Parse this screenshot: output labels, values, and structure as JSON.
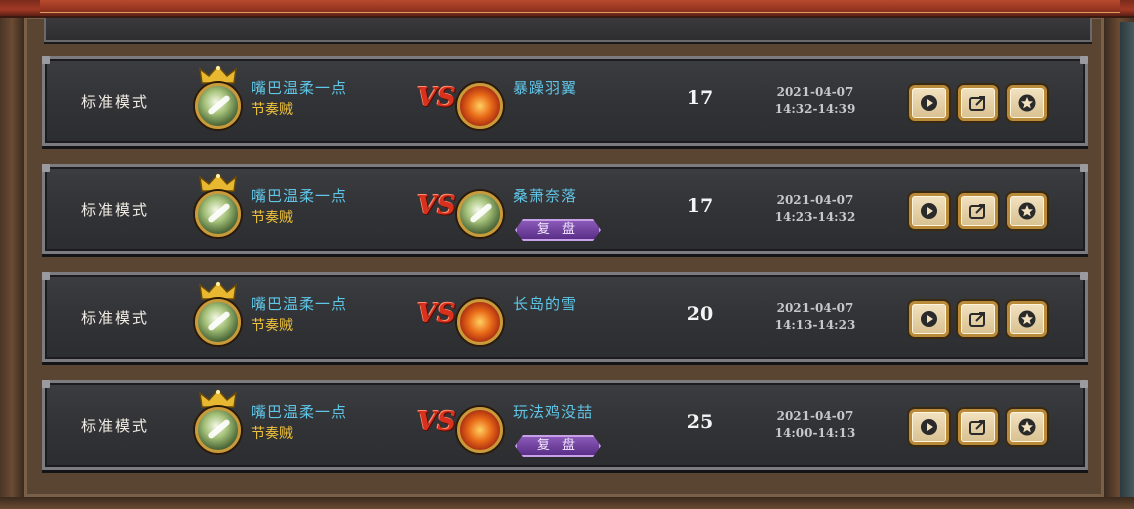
{
  "colors": {
    "accent_name": "#5fc6e8",
    "class_color": "#f0c23a",
    "vs_red": "#d8321e",
    "replay_purple": "#6a3a9a"
  },
  "buttons": {
    "play_icon": "play-icon",
    "share_icon": "share-icon",
    "favorite_icon": "star-icon"
  },
  "matches": [
    {
      "mode": "标准模式",
      "player_name": "嘴巴温柔一点",
      "player_class": "节奏贼",
      "opponent_name": "暴躁羽翼",
      "opponent_avatar": "fire",
      "replay_label": "",
      "turns": "17",
      "date": "2021-04-07",
      "time": "14:32-14:39"
    },
    {
      "mode": "标准模式",
      "player_name": "嘴巴温柔一点",
      "player_class": "节奏贼",
      "opponent_name": "桑萧奈落",
      "opponent_avatar": "rogue",
      "replay_label": "复 盘",
      "turns": "17",
      "date": "2021-04-07",
      "time": "14:23-14:32"
    },
    {
      "mode": "标准模式",
      "player_name": "嘴巴温柔一点",
      "player_class": "节奏贼",
      "opponent_name": "长岛的雪",
      "opponent_avatar": "fire",
      "replay_label": "",
      "turns": "20",
      "date": "2021-04-07",
      "time": "14:13-14:23"
    },
    {
      "mode": "标准模式",
      "player_name": "嘴巴温柔一点",
      "player_class": "节奏贼",
      "opponent_name": "玩法鸡没喆",
      "opponent_avatar": "fire",
      "replay_label": "复 盘",
      "turns": "25",
      "date": "2021-04-07",
      "time": "14:00-14:13"
    }
  ]
}
